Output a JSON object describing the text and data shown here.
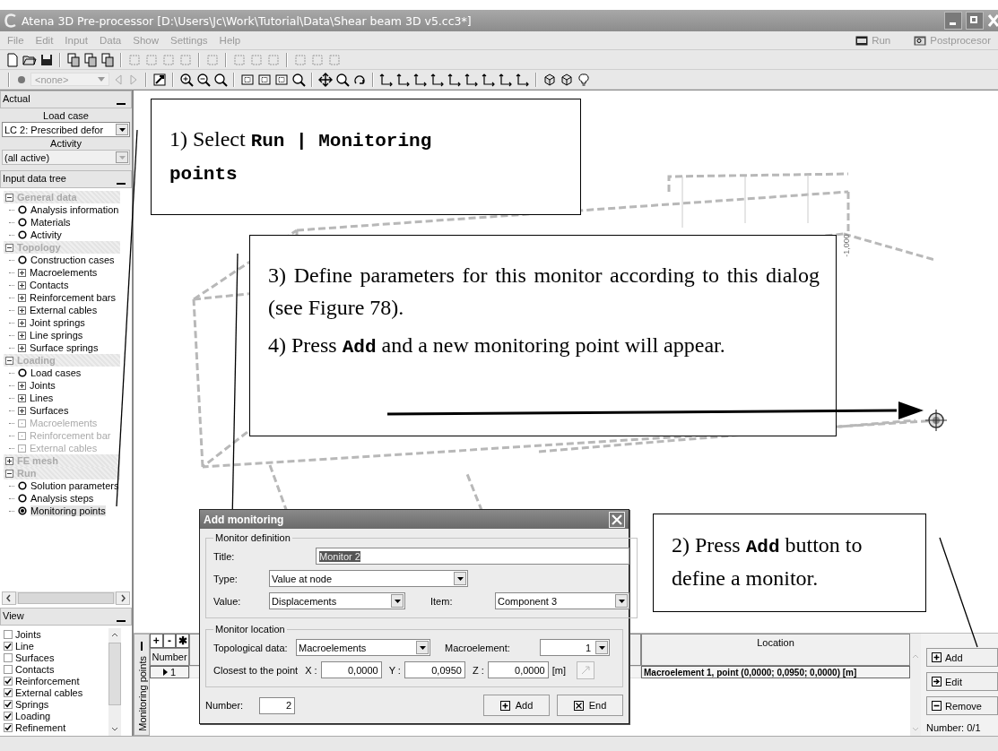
{
  "window": {
    "title": "Atena 3D Pre-processor [D:\\Users\\Jc\\Work\\Tutorial\\Data\\Shear beam 3D v5.cc3*]"
  },
  "menu": [
    "File",
    "Edit",
    "Input",
    "Data",
    "Show",
    "Settings",
    "Help"
  ],
  "menu_right": [
    {
      "label": "Run",
      "kind": "run"
    },
    {
      "label": "Postprocesor",
      "kind": "post"
    }
  ],
  "toolbar": {
    "combo": {
      "value": "<none>",
      "disabled": true
    }
  },
  "actual_panel": {
    "header": "Actual",
    "load_case_label": "Load case",
    "load_case": "LC 2: Prescribed defor",
    "activity_label": "Activity",
    "activity": "(all active)",
    "activity_disabled": true
  },
  "tree_panel": {
    "header": "Input data tree",
    "groups": [
      {
        "label": "General data",
        "expanded": true,
        "children": [
          {
            "label": "Analysis information",
            "kind": "leaf",
            "disabled": false,
            "selected": false
          },
          {
            "label": "Materials",
            "kind": "leaf",
            "disabled": false,
            "selected": false
          },
          {
            "label": "Activity",
            "kind": "leaf",
            "disabled": false,
            "selected": false
          }
        ]
      },
      {
        "label": "Topology",
        "expanded": true,
        "children": [
          {
            "label": "Construction cases",
            "kind": "leaf",
            "disabled": false,
            "selected": false
          },
          {
            "label": "Macroelements",
            "kind": "node",
            "disabled": false,
            "selected": false
          },
          {
            "label": "Contacts",
            "kind": "node",
            "disabled": false,
            "selected": false
          },
          {
            "label": "Reinforcement bars",
            "kind": "node",
            "disabled": false,
            "selected": false
          },
          {
            "label": "External cables",
            "kind": "node",
            "disabled": false,
            "selected": false
          },
          {
            "label": "Joint springs",
            "kind": "node",
            "disabled": false,
            "selected": false
          },
          {
            "label": "Line springs",
            "kind": "node",
            "disabled": false,
            "selected": false
          },
          {
            "label": "Surface springs",
            "kind": "node",
            "disabled": false,
            "selected": false
          }
        ]
      },
      {
        "label": "Loading",
        "expanded": true,
        "children": [
          {
            "label": "Load cases",
            "kind": "leaf",
            "disabled": false,
            "selected": false
          },
          {
            "label": "Joints",
            "kind": "node",
            "disabled": false,
            "selected": false
          },
          {
            "label": "Lines",
            "kind": "node",
            "disabled": false,
            "selected": false
          },
          {
            "label": "Surfaces",
            "kind": "node",
            "disabled": false,
            "selected": false
          },
          {
            "label": "Macroelements",
            "kind": "node",
            "disabled": true,
            "selected": false
          },
          {
            "label": "Reinforcement bar",
            "kind": "node",
            "disabled": true,
            "selected": false
          },
          {
            "label": "External cables",
            "kind": "node",
            "disabled": true,
            "selected": false
          }
        ]
      },
      {
        "label": "FE mesh",
        "expanded": false
      },
      {
        "label": "Run",
        "expanded": true,
        "children": [
          {
            "label": "Solution parameters",
            "kind": "leaf",
            "disabled": false,
            "selected": false
          },
          {
            "label": "Analysis steps",
            "kind": "leaf",
            "disabled": false,
            "selected": false
          },
          {
            "label": "Monitoring points",
            "kind": "leaf",
            "disabled": false,
            "selected": true
          }
        ]
      }
    ]
  },
  "view_panel": {
    "header": "View",
    "items": [
      {
        "label": "Joints",
        "checked": false
      },
      {
        "label": "Line",
        "checked": true
      },
      {
        "label": "Surfaces",
        "checked": false
      },
      {
        "label": "Contacts",
        "checked": false
      },
      {
        "label": "Reinforcement",
        "checked": true
      },
      {
        "label": "External cables",
        "checked": true
      },
      {
        "label": "Springs",
        "checked": true
      },
      {
        "label": "Loading",
        "checked": true
      },
      {
        "label": "Refinement",
        "checked": true
      }
    ]
  },
  "canvas": {
    "axis_label": "-1,000"
  },
  "callouts": [
    {
      "paragraphs": [
        "1) Select **Run | Monitoring points**"
      ]
    },
    {
      "paragraphs": [
        "3) Define parameters for this monitor according to this dialog (see Figure 78).",
        "4) Press **Add** and a new monitoring point will appear."
      ]
    },
    {
      "paragraphs": [
        "2) Press **Add** button to define a monitor."
      ]
    }
  ],
  "dialog": {
    "title": "Add monitoring",
    "definition": {
      "legend": "Monitor definition",
      "title_label": "Title:",
      "title_value": "Monitor 2",
      "title_selected": true,
      "type_label": "Type:",
      "type_value": "Value at node",
      "value_label": "Value:",
      "value_value": "Displacements",
      "item_label": "Item:",
      "item_value": "Component 3"
    },
    "location": {
      "legend": "Monitor location",
      "topo_label": "Topological data:",
      "topo_value": "Macroelements",
      "macro_label": "Macroelement:",
      "macro_value": "1",
      "point_label": "Closest to the point",
      "coords": [
        {
          "label": "X :",
          "value": "0,0000"
        },
        {
          "label": "Y :",
          "value": "0,0950"
        },
        {
          "label": "Z :",
          "value": "0,0000"
        }
      ],
      "unit": "[m]",
      "pick_disabled": true
    },
    "number_label": "Number:",
    "number_value": "2",
    "buttons": [
      {
        "label": "Add",
        "kind": "add"
      },
      {
        "label": "End",
        "kind": "end"
      }
    ]
  },
  "monitor_panel": {
    "tab": "Monitoring points",
    "grid_buttons": [
      "+",
      "-",
      "✱"
    ],
    "columns": [
      "Number",
      "Location"
    ],
    "rows": [
      {
        "number": "1",
        "location": "Macroelement 1, point (0,0000; 0,0950; 0,0000) [m]",
        "selected": true
      }
    ],
    "buttons": [
      {
        "label": "Add",
        "kind": "add"
      },
      {
        "label": "Edit",
        "kind": "edit"
      },
      {
        "label": "Remove",
        "kind": "remove"
      }
    ],
    "count": "Number: 0/1"
  }
}
